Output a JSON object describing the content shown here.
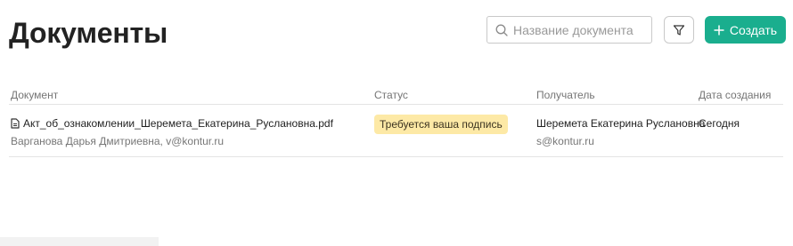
{
  "header": {
    "title": "Документы",
    "search_placeholder": "Название документа",
    "search_value": "",
    "create_label": "Создать"
  },
  "icons": {
    "search": "search-icon",
    "filter": "filter-icon",
    "plus": "plus-icon",
    "document": "document-icon"
  },
  "colors": {
    "accent": "#1aae8e",
    "status_badge_bg": "#fde9a6"
  },
  "table": {
    "columns": [
      "Документ",
      "Статус",
      "Получатель",
      "Дата создания"
    ],
    "rows": [
      {
        "document": "Акт_об_ознакомлении_Шеремета_Екатерина_Руслановна.pdf",
        "author": "Варганова Дарья Дмитриевна, v@kontur.ru",
        "status": "Требуется ваша подпись",
        "recipient_name": "Шеремета Екатерина Руслановна",
        "recipient_email": "s@kontur.ru",
        "date": "Сегодня"
      }
    ]
  }
}
